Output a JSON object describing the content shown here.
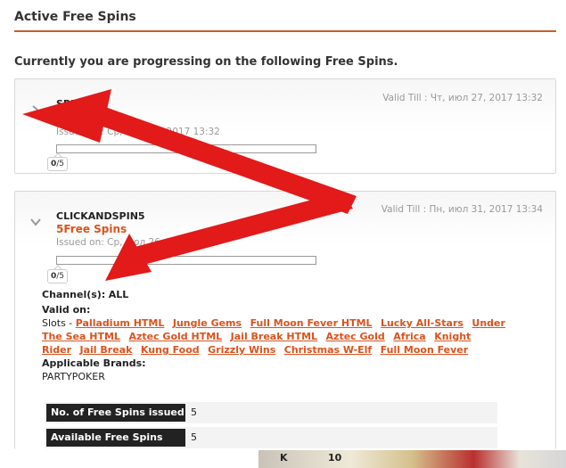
{
  "page": {
    "title": "Active Free Spins",
    "subtitle": "Currently you are progressing on the following Free Spins."
  },
  "cards": [
    {
      "name": "SPINS5",
      "spins": "5Free Spins",
      "valid_till": "Valid Till : Чт, июл 27, 2017 13:32",
      "issued_on": "Issued on: Ср, июл 26, 2017 13:32",
      "progress": 0,
      "counter_done": "0",
      "counter_total": "/5"
    },
    {
      "name": "CLICKANDSPIN5",
      "spins": "5Free Spins",
      "valid_till": "Valid Till : Пн, июл 31, 2017 13:34",
      "issued_on": "Issued on: Ср, июл 26, 2017",
      "progress": 0,
      "counter_done": "0",
      "counter_total": "/5",
      "channels_label": "Channel(s):",
      "channels_value": "ALL",
      "valid_on_label": "Valid on:",
      "slots_prefix": "Slots - ",
      "games": [
        "Palladium HTML",
        "Jungle Gems",
        "Full Moon Fever HTML",
        "Lucky All-Stars",
        "Under The Sea HTML",
        "Aztec Gold HTML",
        "Jail Break HTML",
        "Aztec Gold",
        "Africa",
        "Knight Rider",
        "Jail Break",
        "Kung Food",
        "Grizzly Wins",
        "Christmas W-Elf",
        "Full Moon Fever"
      ],
      "brands_label": "Applicable Brands:",
      "brands_value": "PARTYPOKER",
      "stats": [
        {
          "label": "No. of Free Spins issued",
          "value": "5"
        },
        {
          "label": "Available Free Spins",
          "value": "5"
        }
      ]
    }
  ],
  "icons": {
    "expand": "chevron-right-icon",
    "collapse": "chevron-down-icon"
  },
  "colors": {
    "accent": "#d9531e",
    "rule": "#c8602a",
    "annotation_arrow": "#e21a1a"
  },
  "banner": {
    "text_left": "K",
    "text_mid": "10"
  }
}
